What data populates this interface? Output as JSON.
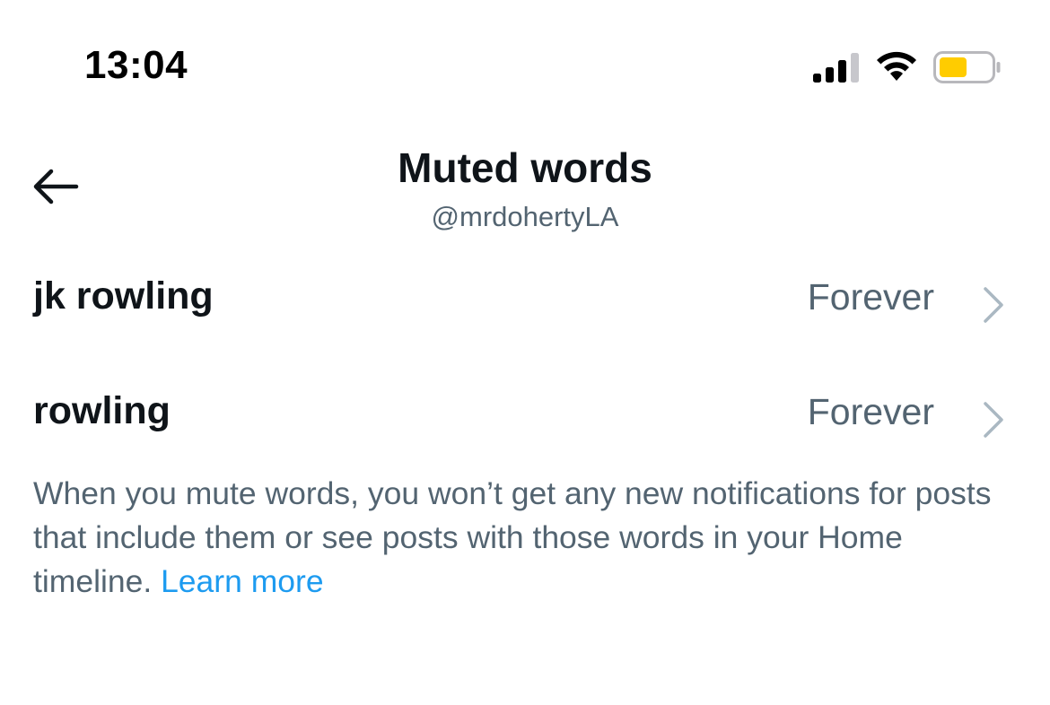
{
  "status_bar": {
    "time": "13:04",
    "signal_icon": "cellular-signal-icon",
    "wifi_icon": "wifi-icon",
    "battery_icon": "battery-icon",
    "battery_color": "#ffcc00"
  },
  "header": {
    "back_icon": "back-arrow-icon",
    "title": "Muted words",
    "subtitle": "@mrdohertyLA"
  },
  "muted_words": [
    {
      "word": "jk rowling",
      "duration": "Forever"
    },
    {
      "word": "rowling",
      "duration": "Forever"
    }
  ],
  "description": {
    "text": "When you mute words, you won’t get any new notifications for posts that include them or see posts with those words in your Home timeline. ",
    "link": "Learn more"
  },
  "colors": {
    "primary_text": "#0f1419",
    "secondary_text": "#536471",
    "link": "#1d9bf0",
    "chevron": "#aab8c2"
  }
}
